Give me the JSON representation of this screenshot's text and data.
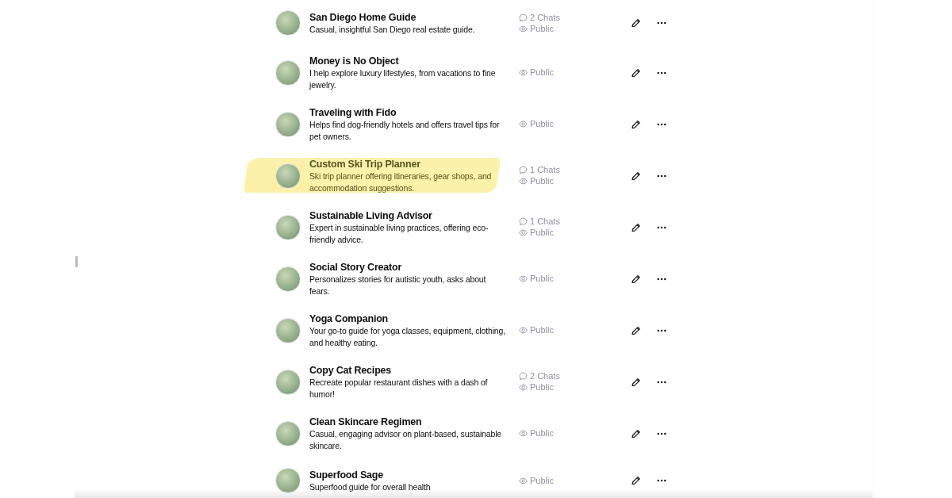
{
  "gpts": [
    {
      "name": "San Diego Home Guide",
      "description": "Casual, insightful San Diego real estate guide.",
      "chats": "2 Chats",
      "visibility": "Public",
      "highlighted": false
    },
    {
      "name": "Money is No Object",
      "description": "I help explore luxury lifestyles, from vacations to fine jewelry.",
      "visibility": "Public",
      "highlighted": false
    },
    {
      "name": "Traveling with Fido",
      "description": "Helps find dog-friendly hotels and offers travel tips for pet owners.",
      "visibility": "Public",
      "highlighted": false
    },
    {
      "name": "Custom Ski Trip Planner",
      "description": "Ski trip planner offering itineraries, gear shops, and accommodation suggestions.",
      "chats": "1 Chats",
      "visibility": "Public",
      "highlighted": true
    },
    {
      "name": "Sustainable Living Advisor",
      "description": "Expert in sustainable living practices, offering eco-friendly advice.",
      "chats": "1 Chats",
      "visibility": "Public",
      "highlighted": false
    },
    {
      "name": "Social Story Creator",
      "description": "Personalizes stories for autistic youth, asks about fears.",
      "visibility": "Public",
      "highlighted": false
    },
    {
      "name": "Yoga Companion",
      "description": "Your go-to guide for yoga classes, equipment, clothing, and healthy eating.",
      "visibility": "Public",
      "highlighted": false
    },
    {
      "name": "Copy Cat Recipes",
      "description": "Recreate popular restaurant dishes with a dash of humor!",
      "chats": "2 Chats",
      "visibility": "Public",
      "highlighted": false
    },
    {
      "name": "Clean Skincare Regimen",
      "description": "Casual, engaging advisor on plant-based, sustainable skincare.",
      "visibility": "Public",
      "highlighted": false
    },
    {
      "name": "Superfood Sage",
      "description": "Superfood guide for overall health",
      "visibility": "Public",
      "highlighted": false
    }
  ]
}
